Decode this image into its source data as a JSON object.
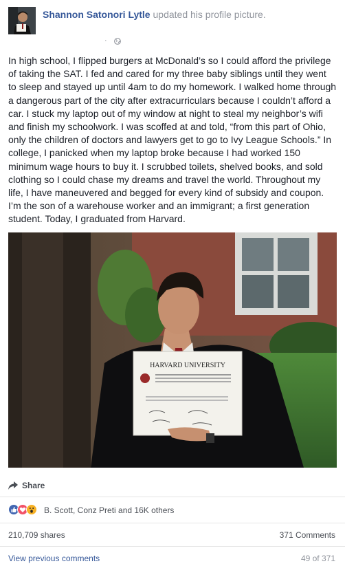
{
  "post": {
    "author_name": "Shannon Satonori Lytle",
    "action_text": "updated his profile picture.",
    "separator": "·",
    "body": "In high school, I flipped burgers at McDonald’s so I could afford the privilege of taking the SAT. I fed and cared for my three baby siblings until they went to sleep and stayed up until 4am to do my homework. I walked home through a dangerous part of the city after extracurriculars because I couldn’t afford a car. I stuck my laptop out of my window at night to steal my neighbor’s wifi and finish my schoolwork. I was scoffed at and told, “from this part of Ohio, only the children of doctors and lawyers get to go to Ivy League Schools.” In college, I panicked when my laptop broke because I had worked 150 minimum wage hours to buy it. I scrubbed toilets, shelved books, and sold clothing so I could chase my dreams and travel the world. Throughout my life, I have maneuvered and begged for every kind of subsidy and coupon. I’m the son of a warehouse worker and an immigrant; a first generation student. Today, I graduated from Harvard.",
    "photo_diploma_title": "HARVARD UNIVERSITY",
    "share_label": "Share",
    "reactions": {
      "icons": [
        "like-icon",
        "love-icon",
        "wow-icon"
      ],
      "names": "B. Scott, Conz Preti and 16K others"
    },
    "shares": "210,709 shares",
    "comments": "371 Comments",
    "view_previous": "View previous comments",
    "comment_page": "49 of 371"
  },
  "colors": {
    "link": "#365899",
    "meta": "#90949c",
    "text": "#1d2129",
    "like": "#4267b2",
    "love": "#f25268",
    "wow": "#f7b125"
  }
}
